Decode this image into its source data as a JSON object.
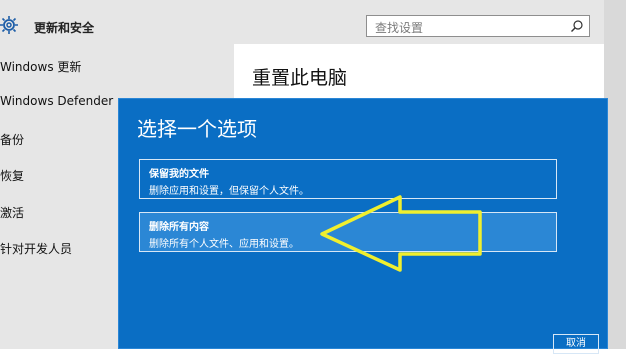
{
  "sidebar": {
    "title": "更新和安全",
    "items": [
      {
        "label": "Windows 更新"
      },
      {
        "label": "Windows Defender"
      },
      {
        "label": "备份"
      },
      {
        "label": "恢复"
      },
      {
        "label": "激活"
      },
      {
        "label": "针对开发人员"
      }
    ]
  },
  "search": {
    "placeholder": "查找设置"
  },
  "main": {
    "page_title": "重置此电脑"
  },
  "dialog": {
    "title": "选择一个选项",
    "options": [
      {
        "title": "保留我的文件",
        "desc": "删除应用和设置，但保留个人文件。"
      },
      {
        "title": "删除所有内容",
        "desc": "删除所有个人文件、应用和设置。"
      }
    ],
    "cancel_label": "取消"
  },
  "colors": {
    "dialog_bg": "#0a6ec4",
    "highlight_arrow": "#f0ef2e"
  }
}
